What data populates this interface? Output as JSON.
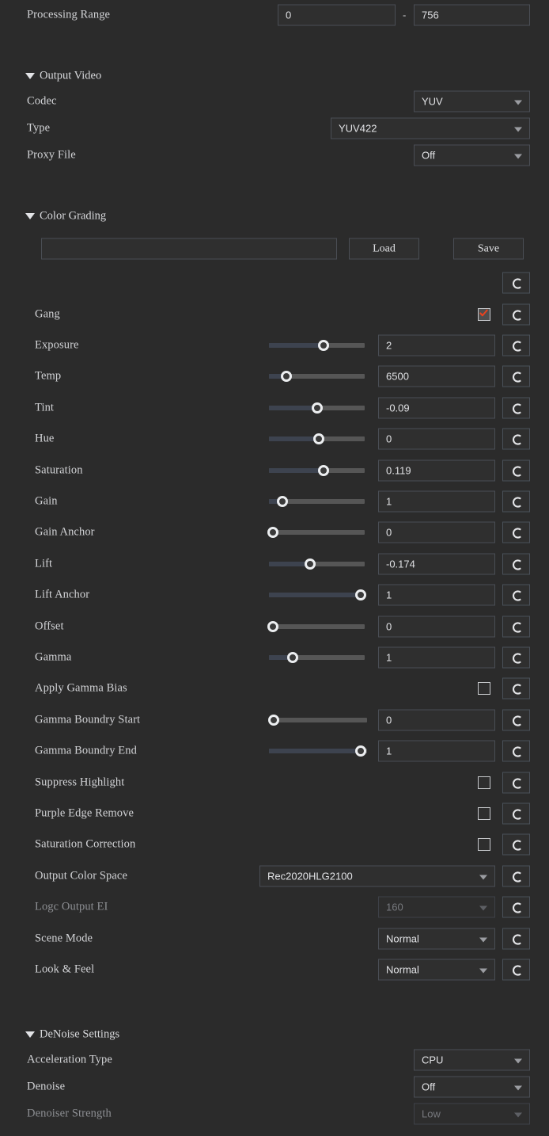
{
  "theme": {
    "background": "#2b2b2b",
    "field_bg": "#2f2f2f",
    "border": "#4a4e55",
    "text": "#d2d3d6",
    "disabled_text": "#77797e",
    "check_accent": "#e8431f",
    "track": "#565656",
    "track_fill": "#3d434f"
  },
  "processing_range": {
    "label": "Processing Range",
    "start_value": "0",
    "separator": "-",
    "end_value": "756"
  },
  "output_video": {
    "section_title": "Output Video",
    "rows": [
      {
        "label": "Codec",
        "value": "YUV"
      },
      {
        "label": "Type",
        "value": "YUV422"
      },
      {
        "label": "Proxy File",
        "value": "Off"
      }
    ]
  },
  "color_grading": {
    "section_title": "Color Grading",
    "preset_value": "",
    "load_label": "Load",
    "save_label": "Save",
    "gang": {
      "label": "Gang",
      "checked": true
    },
    "sliders": [
      {
        "label": "Exposure",
        "value": "2",
        "fill": 0.57
      },
      {
        "label": "Temp",
        "value": "6500",
        "fill": 0.18
      },
      {
        "label": "Tint",
        "value": "-0.09",
        "fill": 0.5
      },
      {
        "label": "Hue",
        "value": "0",
        "fill": 0.52
      },
      {
        "label": "Saturation",
        "value": "0.119",
        "fill": 0.57
      },
      {
        "label": "Gain",
        "value": "1",
        "fill": 0.14
      },
      {
        "label": "Gain Anchor",
        "value": "0",
        "fill": 0.04
      },
      {
        "label": "Lift",
        "value": "-0.174",
        "fill": 0.43
      },
      {
        "label": "Lift Anchor",
        "value": "1",
        "fill": 0.955
      },
      {
        "label": "Offset",
        "value": "0",
        "fill": 0.04
      },
      {
        "label": "Gamma",
        "value": "1",
        "fill": 0.245
      }
    ],
    "apply_gamma_bias": {
      "label": "Apply Gamma Bias",
      "checked": false
    },
    "gamma_boundry": [
      {
        "label": "Gamma Boundry Start",
        "value": "0",
        "fill": 0.045
      },
      {
        "label": "Gamma Boundry End",
        "value": "1",
        "fill": 0.935
      }
    ],
    "checkboxes": [
      {
        "label": "Suppress Highlight",
        "checked": false
      },
      {
        "label": "Purple Edge Remove",
        "checked": false
      },
      {
        "label": "Saturation Correction",
        "checked": false
      }
    ],
    "dropdowns": [
      {
        "label": "Output Color Space",
        "value": "Rec2020HLG2100",
        "disabled": false,
        "wide": true
      },
      {
        "label": "Logc Output EI",
        "value": "160",
        "disabled": true,
        "wide": false
      },
      {
        "label": "Scene Mode",
        "value": "Normal",
        "disabled": false,
        "wide": false
      },
      {
        "label": "Look & Feel",
        "value": "Normal",
        "disabled": false,
        "wide": false
      }
    ]
  },
  "denoise": {
    "section_title": "DeNoise Settings",
    "rows": [
      {
        "label": "Acceleration Type",
        "value": "CPU",
        "disabled": false
      },
      {
        "label": "Denoise",
        "value": "Off",
        "disabled": false
      },
      {
        "label": "Denoiser Strength",
        "value": "Low",
        "disabled": true
      }
    ]
  },
  "icons": {
    "reset": "reset-icon",
    "chevron": "chevron-down-icon",
    "collapse": "triangle-down-icon",
    "check": "check-icon"
  }
}
